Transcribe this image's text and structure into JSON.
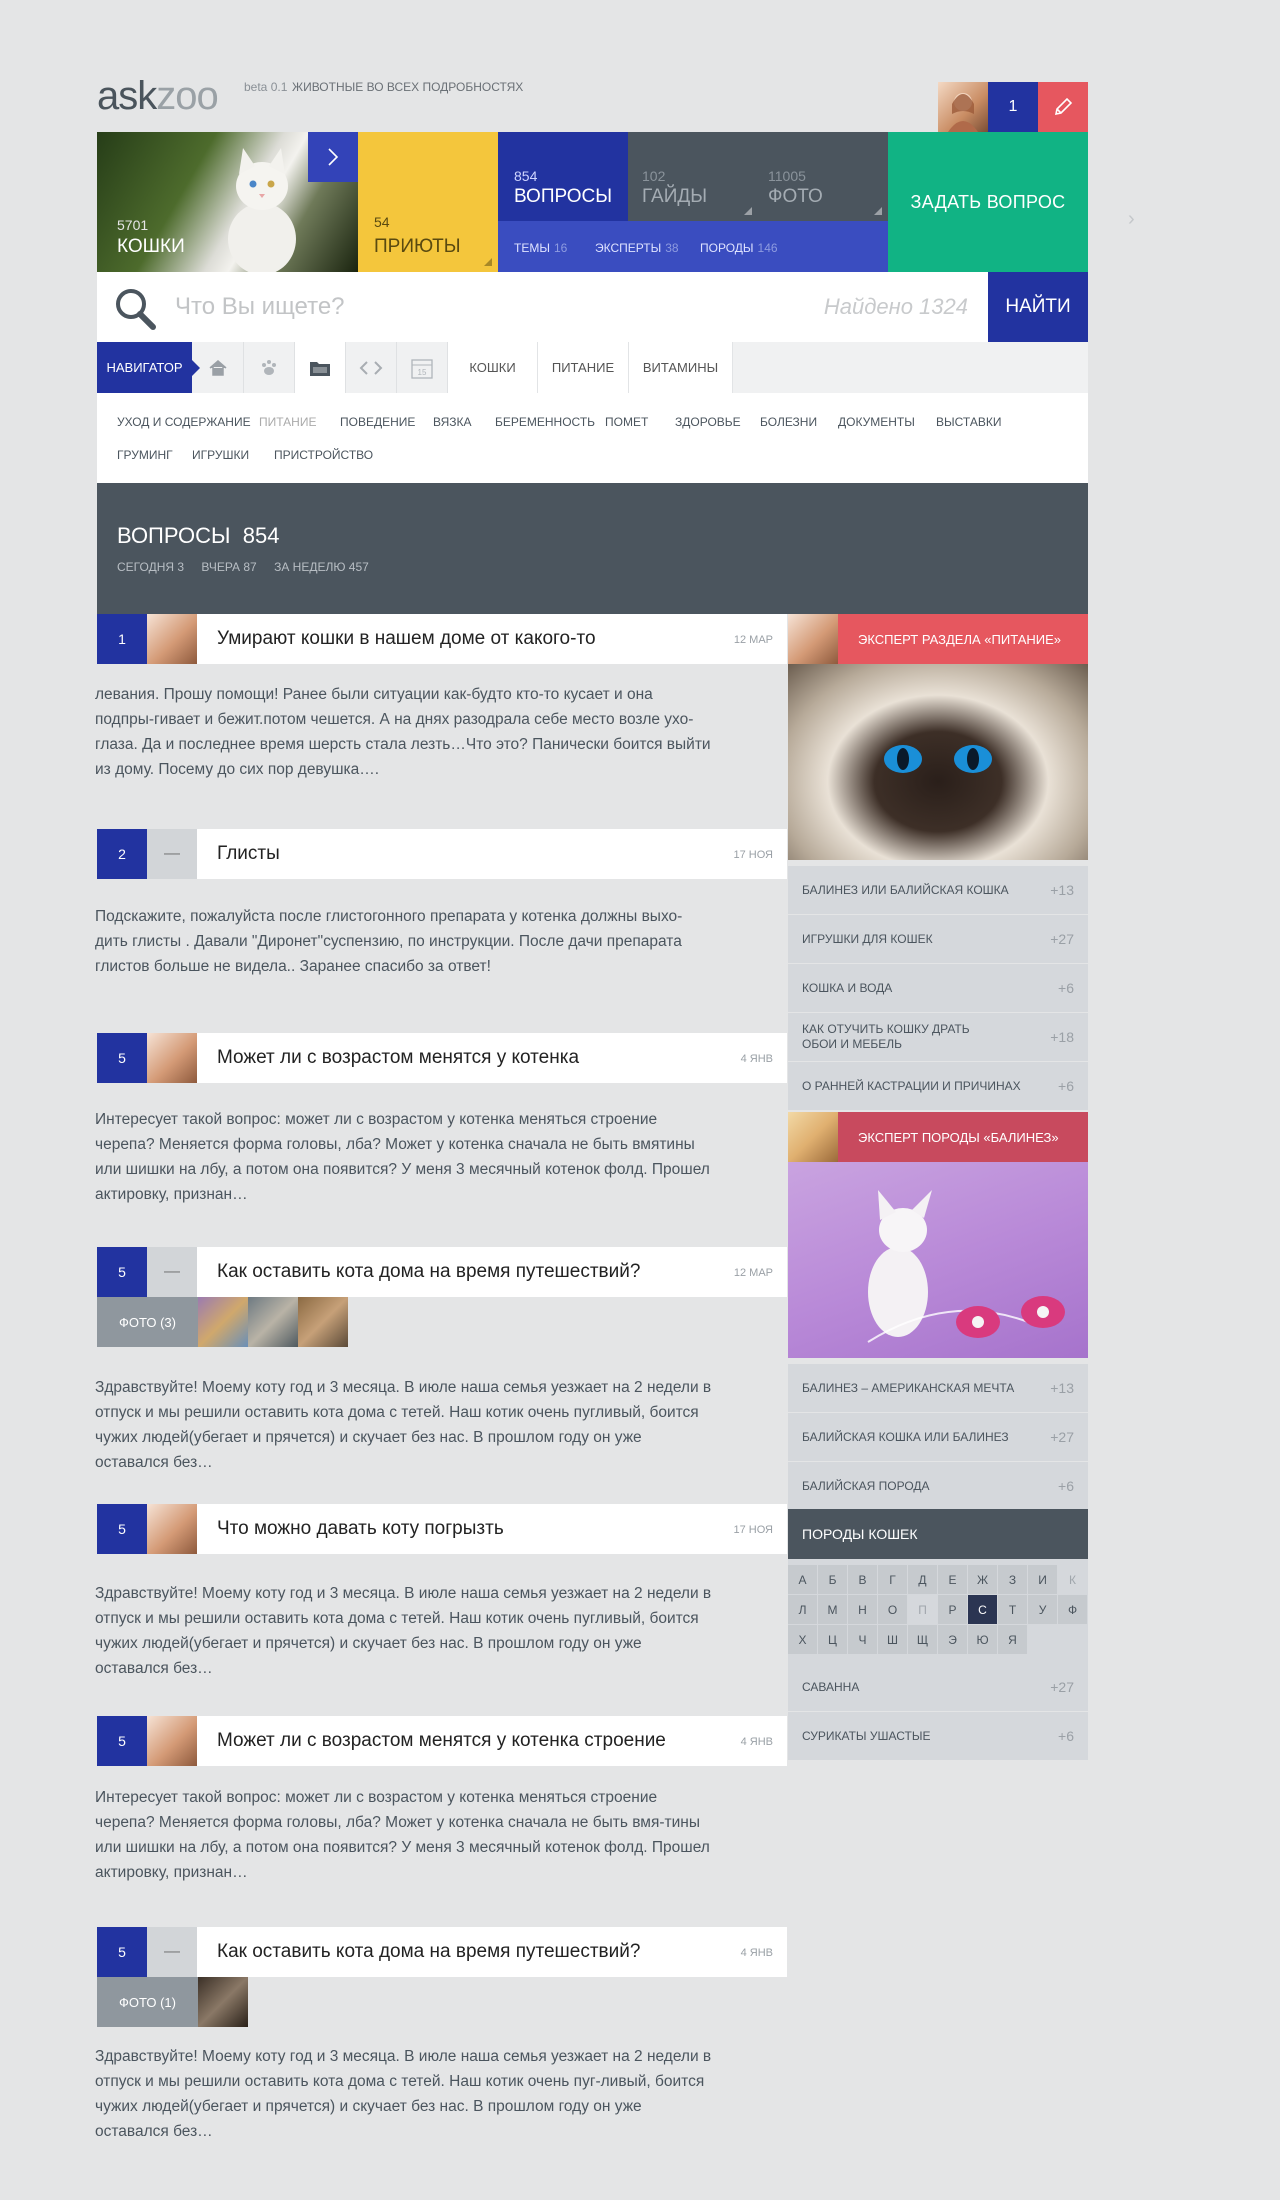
{
  "header": {
    "logo_part1": "ask",
    "logo_part2": "zoo",
    "beta": "beta 0.1",
    "tagline": "ЖИВОТНЫЕ ВО ВСЕХ ПОДРОБНОСТЯХ",
    "user_count": "1",
    "icons": {
      "edit": "pencil-icon",
      "arrow": "chevron-right-icon"
    }
  },
  "tiles": {
    "cats": {
      "count": "5701",
      "label": "КОШКИ"
    },
    "shelters": {
      "count": "54",
      "label": "ПРИЮТЫ"
    },
    "questions": {
      "count": "854",
      "label": "ВОПРОСЫ"
    },
    "guides": {
      "count": "102",
      "label": "ГАЙДЫ"
    },
    "photo": {
      "count": "11005",
      "label": "ФОТО"
    },
    "sub": [
      {
        "label": "ТЕМЫ",
        "count": "16"
      },
      {
        "label": "ЭКСПЕРТЫ",
        "count": "38"
      },
      {
        "label": "ПОРОДЫ",
        "count": "146"
      }
    ],
    "ask_label": "ЗАДАТЬ ВОПРОС"
  },
  "search": {
    "placeholder": "Что Вы ищете?",
    "found": "Найдено 1324",
    "button": "НАЙТИ"
  },
  "navigator": {
    "label": "НАВИГАТОР",
    "icons": [
      "home-icon",
      "paw-icon",
      "folder-icon",
      "code-icon",
      "calendar-icon"
    ],
    "calendar_day": "15",
    "tabs": [
      "КОШКИ",
      "ПИТАНИЕ",
      "ВИТАМИНЫ"
    ],
    "sub_row1": [
      "УХОД И СОДЕРЖАНИЕ",
      "ПИТАНИЕ",
      "ПОВЕДЕНИЕ",
      "ВЯЗКА",
      "БЕРЕМЕННОСТЬ",
      "ПОМЕТ",
      "ЗДОРОВЬЕ",
      "БОЛЕЗНИ",
      "ДОКУМЕНТЫ",
      "ВЫСТАВКИ"
    ],
    "sub_row2": [
      "ГРУМИНГ",
      "ИГРУШКИ",
      "ПРИСТРОЙСТВО"
    ]
  },
  "questions_header": {
    "title": "ВОПРОСЫ",
    "count": "854",
    "today": "СЕГОДНЯ 3",
    "yesterday": "ВЧЕРА 87",
    "week": "ЗА НЕДЕЛЮ 457"
  },
  "questions": [
    {
      "num": "1",
      "title": "Умирают кошки в нашем доме от какого-то",
      "date": "12 МАР",
      "text": "левания. Прошу помощи! Ранее были ситуации как-будто кто-то кусает и она подпры-гивает и бежит.потом чешется. А на днях разодрала себе место возле ухо-глаза. Да и последнее время шерсть стала лезть…Что это? Панически боится выйти из дому. Посему до сих пор девушка…."
    },
    {
      "num": "2",
      "dash": "—",
      "title": "Глисты",
      "date": "17 НОЯ",
      "text": "Подскажите, пожалуйста после глистогонного препарата у котенка должны выхо-дить глисты . Давали \"Диронет\"суспензию, по инструкции. После дачи препарата глистов больше не видела.. Заранее спасибо за ответ!"
    },
    {
      "num": "5",
      "title": "Может ли с возрастом менятся у котенка",
      "date": "4 ЯНВ",
      "text": "Интересует такой вопрос: может ли с возрастом у котенка меняться строение черепа? Меняется форма головы, лба? Может у котенка сначала не быть вмятины или шишки на лбу, а потом она появится? У меня 3 месячный котенок фолд. Прошел актировку, признан…"
    },
    {
      "num": "5",
      "dash": "—",
      "title": "Как оставить кота дома на время путешествий?",
      "date": "12 МАР",
      "photos": "ФОТО (3)",
      "text": "Здравствуйте! Моему коту год и 3 месяца. В июле наша семья уезжает на 2 недели в отпуск и мы решили оставить кота дома с тетей. Наш котик очень пугливый, боится чужих людей(убегает и прячется) и скучает без нас. В прошлом году он уже оставался без…"
    },
    {
      "num": "5",
      "title": "Что можно давать коту погрызть",
      "date": "17 НОЯ",
      "text": "Здравствуйте! Моему коту год и 3 месяца. В июле наша семья уезжает на 2 недели в отпуск и мы решили оставить кота дома с тетей. Наш котик очень пугливый, боится чужих людей(убегает и прячется) и скучает без нас. В прошлом году он уже оставался без…"
    },
    {
      "num": "5",
      "title": "Может ли с возрастом менятся у котенка строение",
      "date": "4 ЯНВ",
      "text": "Интересует такой вопрос: может ли с возрастом у котенка меняться строение черепа? Меняется форма головы, лба? Может у котенка сначала не быть вмя-тины или шишки на лбу, а потом она появится? У меня 3 месячный котенок фолд. Прошел актировку, признан…"
    },
    {
      "num": "5",
      "dash": "—",
      "title": "Как оставить кота дома на время путешествий?",
      "date": "4 ЯНВ",
      "photos": "ФОТО (1)",
      "text": "Здравствуйте! Моему коту год и 3 месяца. В июле наша семья уезжает на 2 недели в отпуск и мы решили оставить кота дома с тетей. Наш котик очень пуг-ливый, боится чужих людей(убегает и прячется) и скучает без нас. В прошлом году он уже оставался без…"
    }
  ],
  "sidebar": {
    "expert1": {
      "title": "ЭКСПЕРТ РАЗДЕЛА «ПИТАНИЕ»",
      "items": [
        {
          "label": "БАЛИНЕЗ ИЛИ БАЛИЙСКАЯ КОШКА",
          "count": "+13"
        },
        {
          "label": "ИГРУШКИ ДЛЯ КОШЕК",
          "count": "+27"
        },
        {
          "label": "КОШКА И ВОДА",
          "count": "+6"
        },
        {
          "label": "КАК ОТУЧИТЬ КОШКУ ДРАТЬ ОБОИ И МЕБЕЛЬ",
          "count": "+18"
        },
        {
          "label": "О РАННЕЙ КАСТРАЦИИ И ПРИЧИНАХ",
          "count": "+6"
        }
      ]
    },
    "expert2": {
      "title": "ЭКСПЕРТ ПОРОДЫ «БАЛИНЕЗ»",
      "items": [
        {
          "label": "БАЛИНЕЗ – АМЕРИКАНСКАЯ МЕЧТА",
          "count": "+13"
        },
        {
          "label": "БАЛИЙСКАЯ КОШКА ИЛИ БАЛИНЕЗ",
          "count": "+27"
        },
        {
          "label": "БАЛИЙСКАЯ ПОРОДА",
          "count": "+6"
        }
      ]
    },
    "breeds": {
      "title": "ПОРОДЫ КОШЕК",
      "letters": [
        "А",
        "Б",
        "В",
        "Г",
        "Д",
        "Е",
        "Ж",
        "З",
        "И",
        "К",
        "Л",
        "М",
        "Н",
        "О",
        "П",
        "Р",
        "С",
        "Т",
        "У",
        "Ф",
        "Х",
        "Ц",
        "Ч",
        "Ш",
        "Щ",
        "Э",
        "Ю",
        "Я"
      ],
      "active": "С",
      "disabled": [
        "К",
        "П"
      ],
      "items": [
        {
          "label": "САВАННА",
          "count": "+27"
        },
        {
          "label": "СУРИКАТЫ УШАСТЫЕ",
          "count": "+6"
        }
      ]
    }
  },
  "colors": {
    "blue": "#2233a0",
    "yellow": "#f4c63c",
    "green": "#11b384",
    "slate": "#4b555e",
    "red": "#e6575f",
    "rose": "#c84a5e"
  }
}
